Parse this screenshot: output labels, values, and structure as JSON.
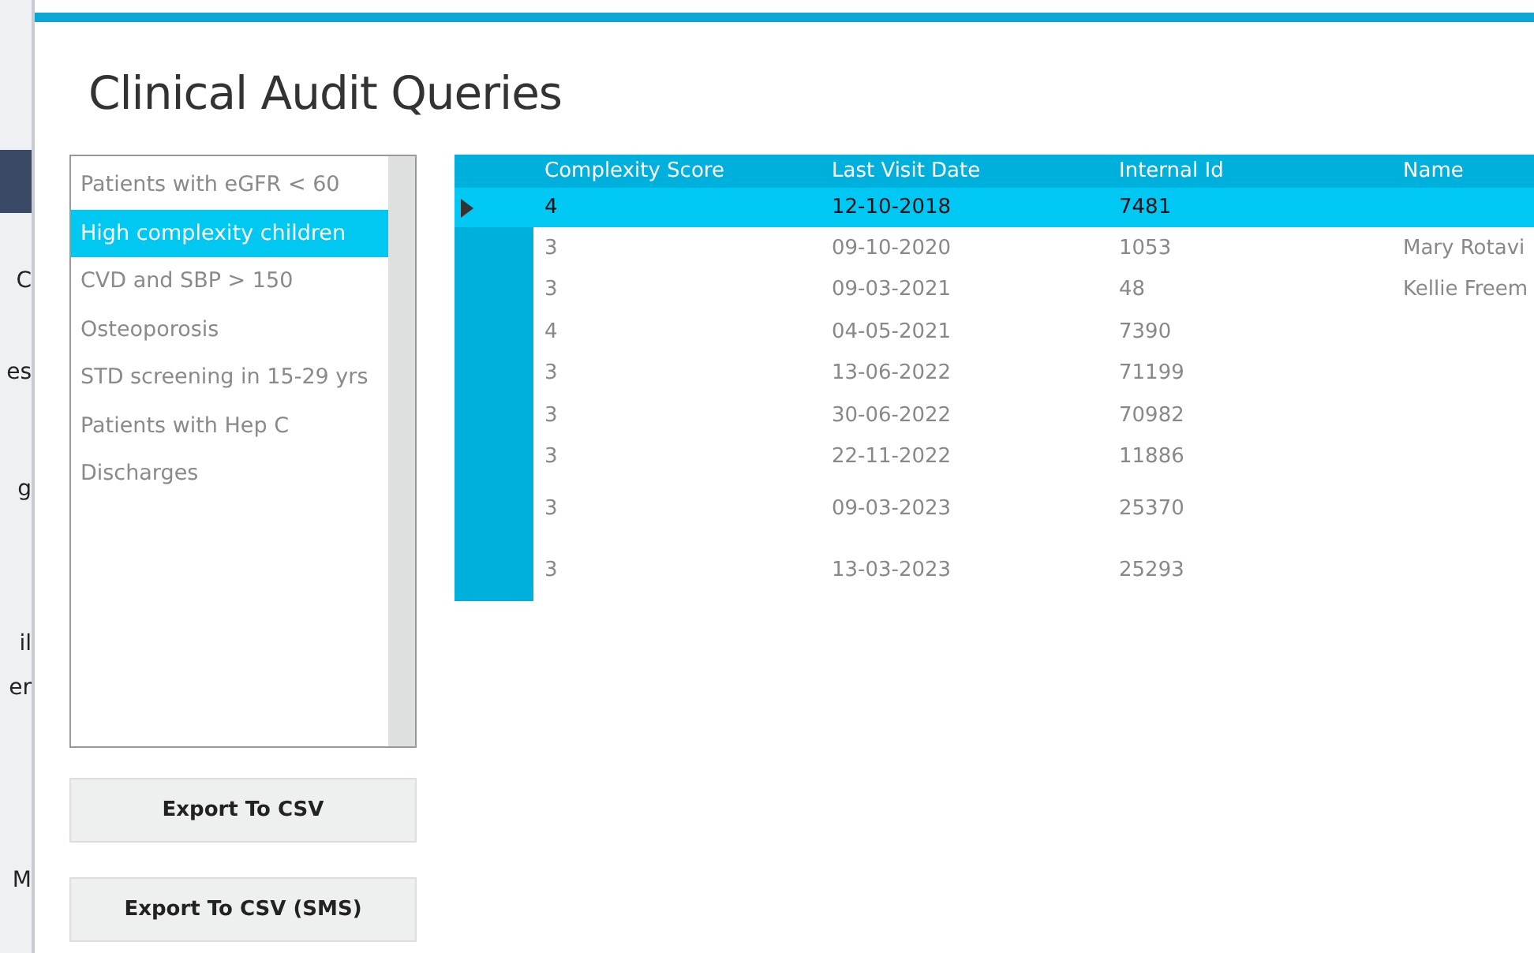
{
  "background_window": {
    "fragments": [
      "C",
      "es",
      "g",
      "il",
      "er",
      "M"
    ]
  },
  "window": {
    "title": "Clinical Audit Queries"
  },
  "queries": [
    {
      "label": "Patients with eGFR < 60",
      "selected": false
    },
    {
      "label": "High complexity children",
      "selected": true
    },
    {
      "label": "CVD and SBP > 150",
      "selected": false
    },
    {
      "label": "Osteoporosis",
      "selected": false
    },
    {
      "label": "STD screening in 15-29 yrs",
      "selected": false
    },
    {
      "label": "Patients with Hep C",
      "selected": false
    },
    {
      "label": "Discharges",
      "selected": false
    }
  ],
  "buttons": [
    "Export To CSV",
    "Export To CSV (SMS)"
  ],
  "table": {
    "columns": [
      "Complexity Score",
      "Last Visit Date",
      "Internal Id",
      "Name"
    ],
    "rows": [
      {
        "cells": [
          "4",
          "12-10-2018",
          "7481",
          ""
        ],
        "selected": true
      },
      {
        "cells": [
          "3",
          "09-10-2020",
          "1053",
          "Mary Rotavi"
        ],
        "selected": false
      },
      {
        "cells": [
          "3",
          "09-03-2021",
          "48",
          "Kellie Freem"
        ],
        "selected": false
      },
      {
        "cells": [
          "4",
          "04-05-2021",
          "7390",
          ""
        ],
        "selected": false
      },
      {
        "cells": [
          "3",
          "13-06-2022",
          "71199",
          ""
        ],
        "selected": false
      },
      {
        "cells": [
          "3",
          "30-06-2022",
          "70982",
          ""
        ],
        "selected": false
      },
      {
        "cells": [
          "3",
          "22-11-2022",
          "11886",
          ""
        ],
        "selected": false
      },
      {
        "cells": [
          "3",
          "09-03-2023",
          "25370",
          ""
        ],
        "selected": false
      },
      {
        "cells": [
          "3",
          "13-03-2023",
          "25293",
          ""
        ],
        "selected": false
      }
    ]
  }
}
